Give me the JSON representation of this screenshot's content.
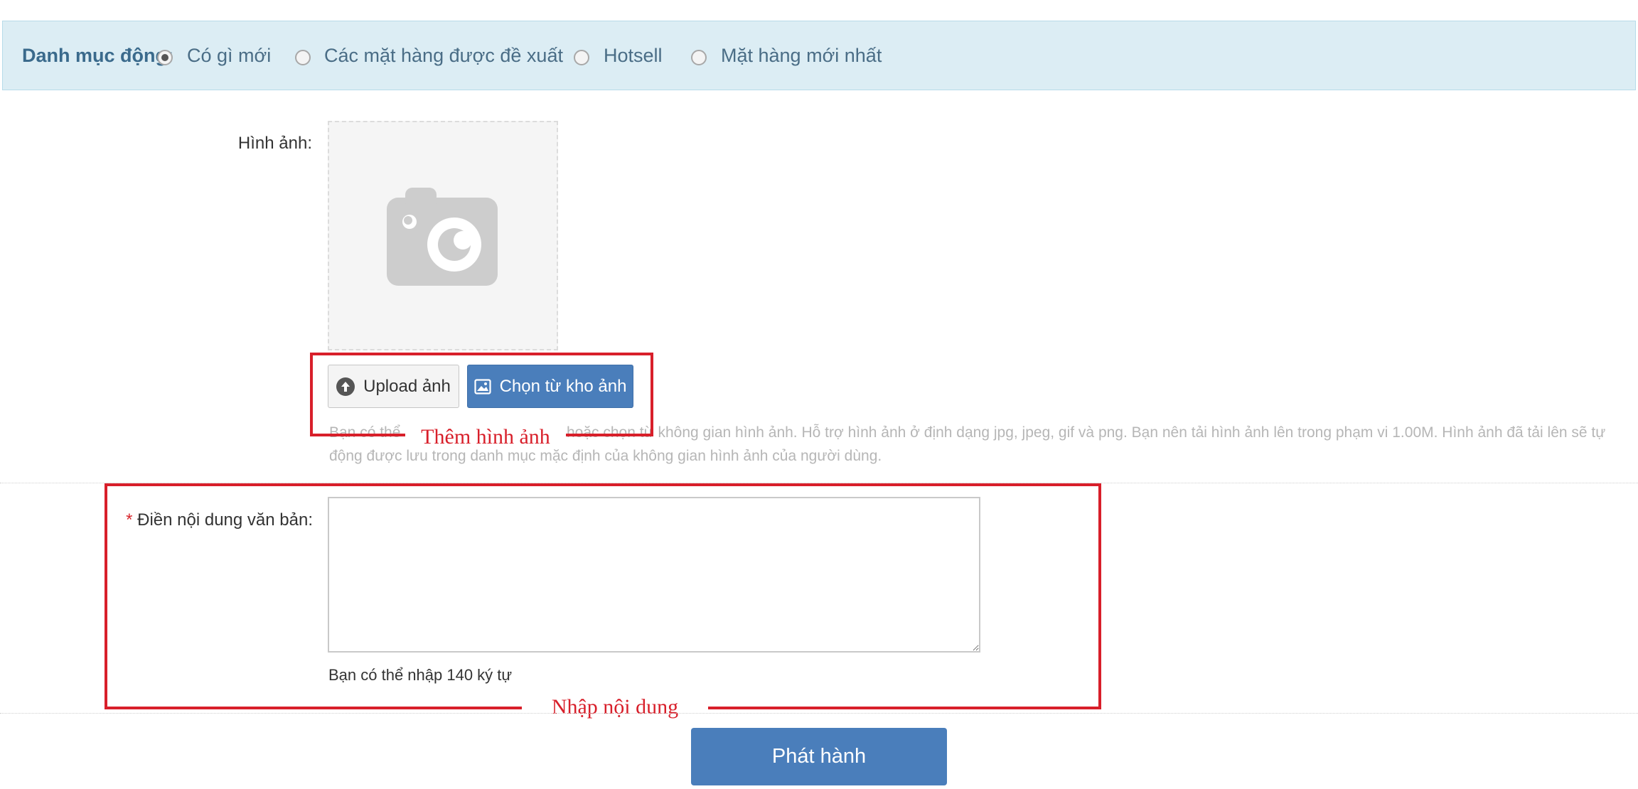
{
  "category": {
    "label": "Danh mục động:",
    "options": [
      {
        "label": "Có gì mới",
        "checked": true
      },
      {
        "label": "Các mặt hàng được đề xuất",
        "checked": false
      },
      {
        "label": "Hotsell",
        "checked": false
      },
      {
        "label": "Mặt hàng mới nhất",
        "checked": false
      }
    ]
  },
  "image_section": {
    "label": "Hình ảnh:",
    "placeholder_icon": "camera-icon",
    "upload_label": "Upload ảnh",
    "upload_icon": "upload-icon",
    "gallery_label": "Chọn từ kho ảnh",
    "gallery_icon": "image-icon",
    "help_line1_start": "Bạn có thể",
    "help_line1_end": "hoặc chọn từ không gian hình ảnh. Hỗ trợ hình ảnh ở định dạng jpg, jpeg, gif và png. Bạn nên tải hình ảnh lên trong phạm vi 1.00M. Hình ảnh đã tải lên sẽ tự",
    "help_line2": "động được lưu trong danh mục mặc định của không gian hình ảnh của người dùng."
  },
  "text_section": {
    "required_mark": "*",
    "label": "Điền nội dung văn bản:",
    "textarea_value": "",
    "char_hint": "Bạn có thể nhập 140 ký tự"
  },
  "annotations": {
    "add_image": "Thêm hình ảnh",
    "enter_content": "Nhập nội dung"
  },
  "publish_label": "Phát hành",
  "colors": {
    "accent": "#4a7ebb",
    "category_bg": "#dcedf4",
    "annotation": "#d81f2a"
  }
}
